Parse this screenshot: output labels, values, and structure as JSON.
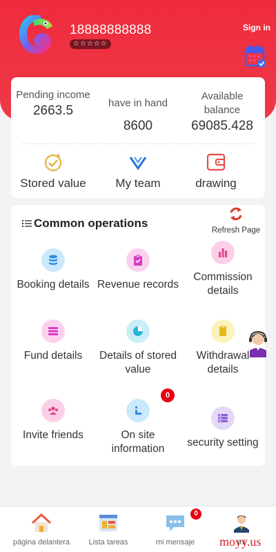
{
  "header": {
    "phone": "18888888888",
    "stars": "☆☆☆☆☆",
    "sign_in": "Sign in"
  },
  "stats": [
    {
      "label": "Pending income",
      "value": "2663.5"
    },
    {
      "label": "have in hand",
      "value": "8600"
    },
    {
      "label": "Available balance",
      "value": "69085.428"
    }
  ],
  "quick_actions": [
    {
      "label": "Stored value",
      "icon": "check-badge-icon"
    },
    {
      "label": "My team",
      "icon": "team-logo-icon"
    },
    {
      "label": "drawing",
      "icon": "wallet-icon"
    }
  ],
  "operations": {
    "title": "Common operations",
    "refresh_label": "Refresh Page",
    "items": [
      {
        "label": "Booking details",
        "icon": "coins-icon",
        "color": "#cbe9fb"
      },
      {
        "label": "Revenue records",
        "icon": "clipboard-icon",
        "color": "#fbd0ef"
      },
      {
        "label": "Commission details",
        "icon": "bar-chart-icon",
        "color": "#fbd0e6"
      },
      {
        "label": "Fund details",
        "icon": "list-icon",
        "color": "#fcd0ef"
      },
      {
        "label": "Details of stored value",
        "icon": "pie-chart-icon",
        "color": "#c9eef8"
      },
      {
        "label": "Withdrawal details",
        "icon": "document-icon",
        "color": "#fbf3bc"
      },
      {
        "label": "Invite friends",
        "icon": "people-icon",
        "color": "#fbd0e6"
      },
      {
        "label": "On site information",
        "icon": "info-icon",
        "color": "#cbe9fb",
        "badge": "0"
      },
      {
        "label": "security setting",
        "icon": "server-icon",
        "color": "#e4d8f7"
      }
    ]
  },
  "tabbar": [
    {
      "label": "página delantera",
      "icon": "home-icon"
    },
    {
      "label": "Lista tareas",
      "icon": "task-list-icon"
    },
    {
      "label": "mi mensaje",
      "icon": "message-icon",
      "badge": "0"
    },
    {
      "label": "mi",
      "icon": "user-icon"
    }
  ],
  "watermark": "moyy.us",
  "colors": {
    "primary": "#ef2b3c",
    "badge": "#e60012"
  }
}
